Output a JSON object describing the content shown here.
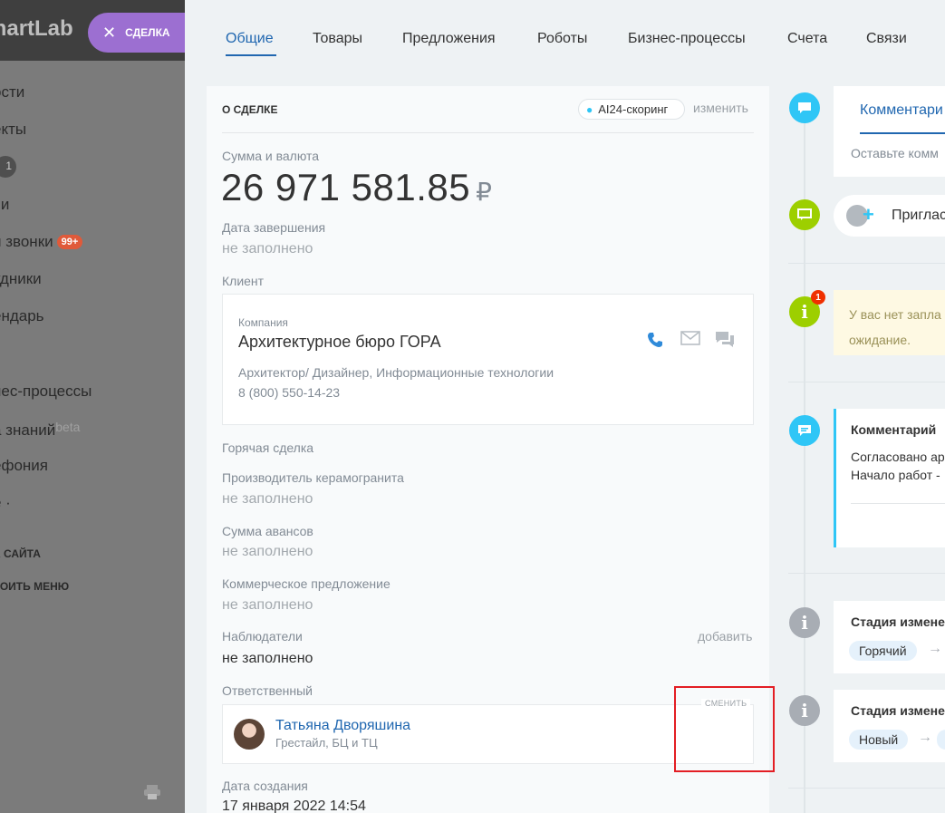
{
  "sidebar": {
    "brand": "martLab",
    "deal_button": "СДЕЛКА",
    "items": [
      {
        "label": "ости"
      },
      {
        "label": "екты"
      },
      {
        "label": "чи"
      },
      {
        "label": "и звонки",
        "badge": "99+"
      },
      {
        "label": "удники"
      },
      {
        "label": "ендарь"
      },
      {
        "label": "к"
      },
      {
        "label": "нес-процессы"
      },
      {
        "label": "а знаний",
        "suffix": "beta"
      },
      {
        "label": "ефония"
      },
      {
        "label": "е ·"
      }
    ],
    "counter": "1",
    "small_items": [
      "А САЙТА",
      "РОИТЬ МЕНЮ"
    ]
  },
  "tabs": [
    "Общие",
    "Товары",
    "Предложения",
    "Роботы",
    "Бизнес-процессы",
    "Счета",
    "Связи"
  ],
  "deal": {
    "title": "О СДЕЛКЕ",
    "ai_scoring": "AI24-скоринг",
    "change": "изменить",
    "amount_label": "Сумма и валюта",
    "amount": "26 971 581.85",
    "currency": "₽",
    "end_date_label": "Дата завершения",
    "end_date": "не заполнено",
    "client_label": "Клиент",
    "client": {
      "type": "Компания",
      "name": "Архитектурное бюро ГОРА",
      "description": "Архитектор/ Дизайнер, Информационные технологии",
      "phone": "8 (800) 550-14-23"
    },
    "hot_deal": "Горячая сделка",
    "manufacturer_label": "Производитель керамогранита",
    "manufacturer": "не заполнено",
    "advance_label": "Сумма авансов",
    "advance": "не заполнено",
    "offer_label": "Коммерческое предложение",
    "offer": "не заполнено",
    "observers_label": "Наблюдатели",
    "observers_add": "добавить",
    "observers": "не заполнено",
    "responsible_label": "Ответственный",
    "responsible": {
      "name": "Татьяна Дворяшина",
      "sub": "Грестайл, БЦ и ТЦ",
      "change": "СМЕНИТЬ"
    },
    "created_label": "Дата создания",
    "created": "17 января 2022 14:54"
  },
  "timeline": {
    "comment_tab": "Комментари",
    "comment_placeholder": "Оставьте комм",
    "invite": "Приглас",
    "notice_count": "1",
    "warning_line1": "У вас нет запла",
    "warning_line2": "ожидание.",
    "comment_title": "Комментарий",
    "comment_line1": "Согласовано ар",
    "comment_line2": "Начало работ -",
    "stage1_title": "Стадия измене",
    "stage1_pill": "Горячий",
    "stage2_title": "Стадия измене",
    "stage2_pill": "Новый"
  },
  "colors": {
    "accent": "#2067b0",
    "timeline_blue": "#2fc6f6",
    "timeline_green": "#9dcf00",
    "highlight": "#e31e24"
  }
}
